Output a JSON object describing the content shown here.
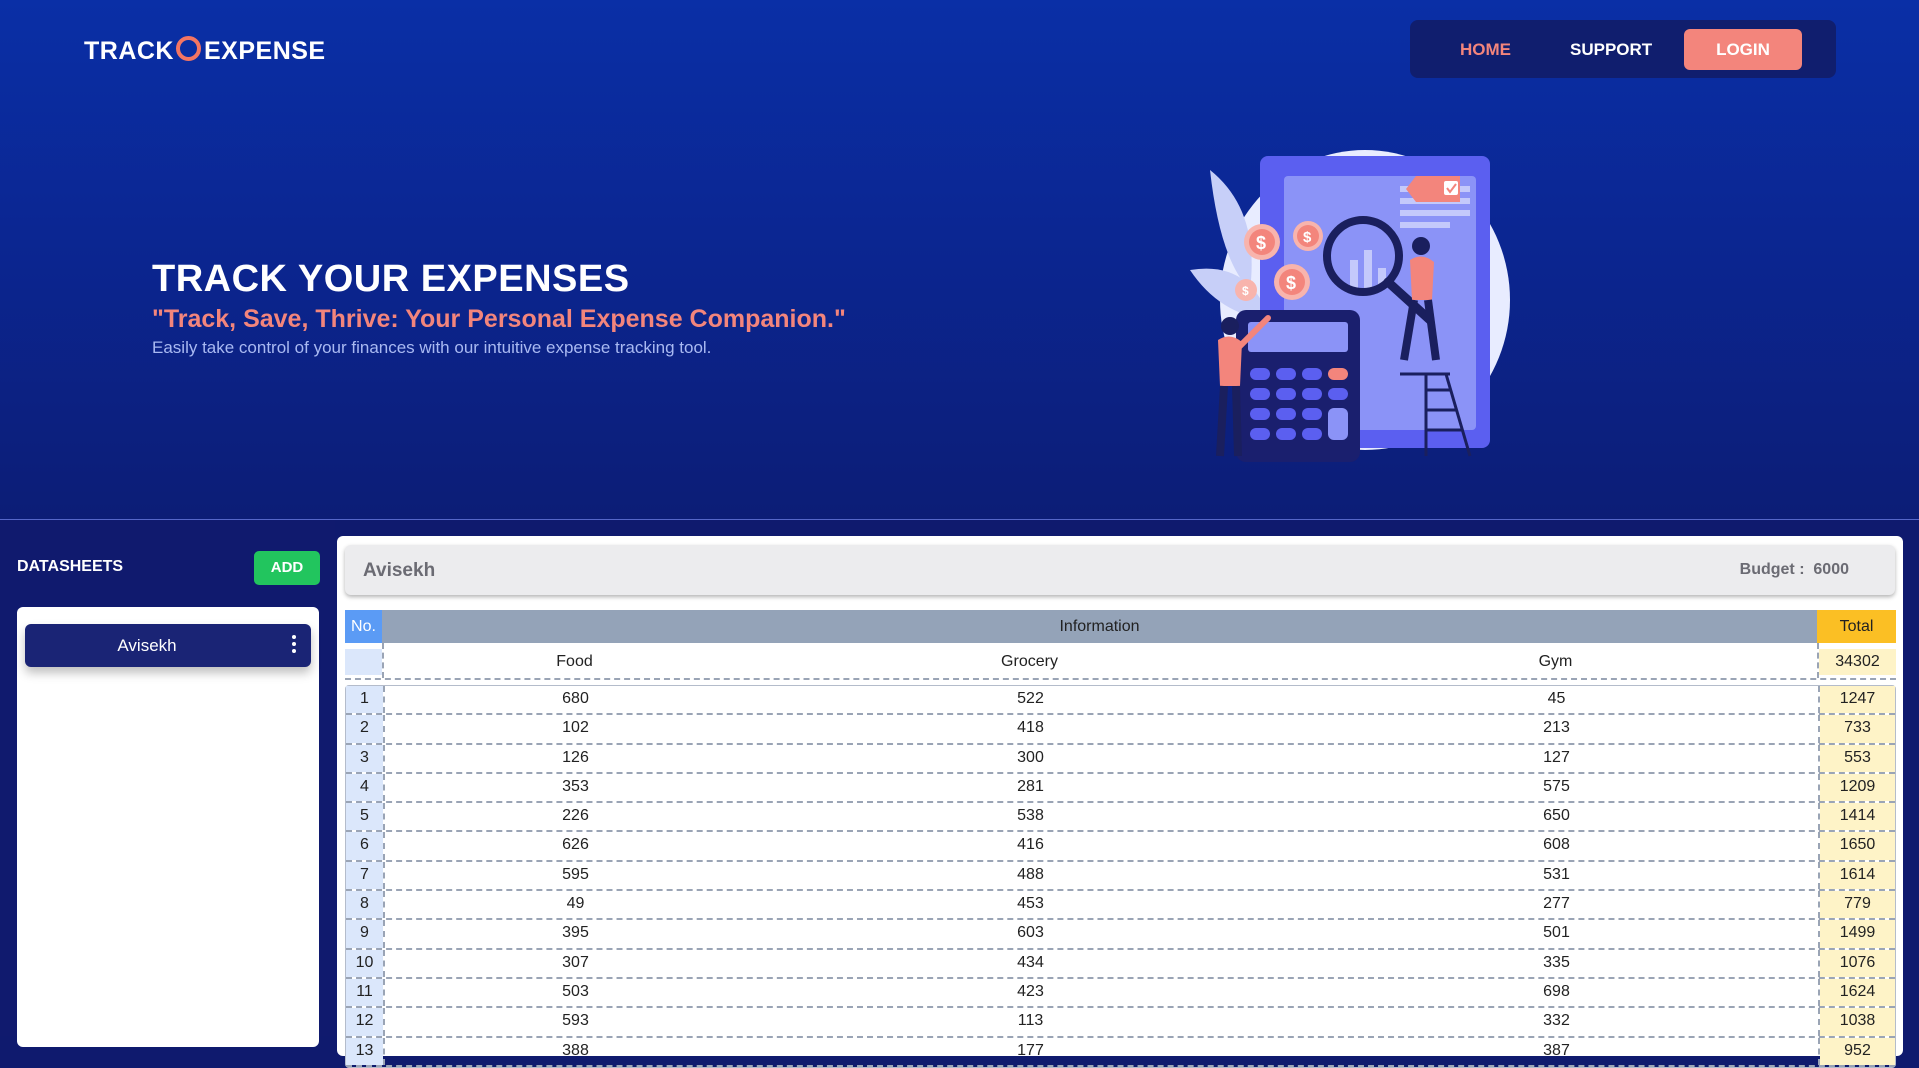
{
  "brand": {
    "part1": "TRACK",
    "part2": "EXPENSE"
  },
  "nav": {
    "home": "HOME",
    "support": "SUPPORT",
    "login": "LOGIN"
  },
  "hero": {
    "title": "TRACK YOUR EXPENSES",
    "quote": "\"Track, Save, Thrive: Your Personal Expense Companion.\"",
    "subtitle": "Easily take control of your finances with our intuitive expense tracking tool."
  },
  "sidebar": {
    "title": "DATASHEETS",
    "add_label": "ADD",
    "sheets": [
      {
        "name": "Avisekh"
      }
    ]
  },
  "sheet": {
    "name": "Avisekh",
    "budget_label": "Budget :",
    "budget_value": "6000"
  },
  "table": {
    "no_header": "No.",
    "info_header": "Information",
    "total_header": "Total",
    "categories": [
      "Food",
      "Grocery",
      "Gym"
    ],
    "grand_total": "34302",
    "rows": [
      {
        "no": "1",
        "values": [
          "680",
          "522",
          "45"
        ],
        "total": "1247"
      },
      {
        "no": "2",
        "values": [
          "102",
          "418",
          "213"
        ],
        "total": "733"
      },
      {
        "no": "3",
        "values": [
          "126",
          "300",
          "127"
        ],
        "total": "553"
      },
      {
        "no": "4",
        "values": [
          "353",
          "281",
          "575"
        ],
        "total": "1209"
      },
      {
        "no": "5",
        "values": [
          "226",
          "538",
          "650"
        ],
        "total": "1414"
      },
      {
        "no": "6",
        "values": [
          "626",
          "416",
          "608"
        ],
        "total": "1650"
      },
      {
        "no": "7",
        "values": [
          "595",
          "488",
          "531"
        ],
        "total": "1614"
      },
      {
        "no": "8",
        "values": [
          "49",
          "453",
          "277"
        ],
        "total": "779"
      },
      {
        "no": "9",
        "values": [
          "395",
          "603",
          "501"
        ],
        "total": "1499"
      },
      {
        "no": "10",
        "values": [
          "307",
          "434",
          "335"
        ],
        "total": "1076"
      },
      {
        "no": "11",
        "values": [
          "503",
          "423",
          "698"
        ],
        "total": "1624"
      },
      {
        "no": "12",
        "values": [
          "593",
          "113",
          "332"
        ],
        "total": "1038"
      },
      {
        "no": "13",
        "values": [
          "388",
          "177",
          "387"
        ],
        "total": "952"
      }
    ]
  },
  "colors": {
    "accent": "#f3857c",
    "add_button": "#22c55e",
    "no_header": "#5b9bf5",
    "info_header": "#94a3b8",
    "total_header": "#fbbf24"
  }
}
